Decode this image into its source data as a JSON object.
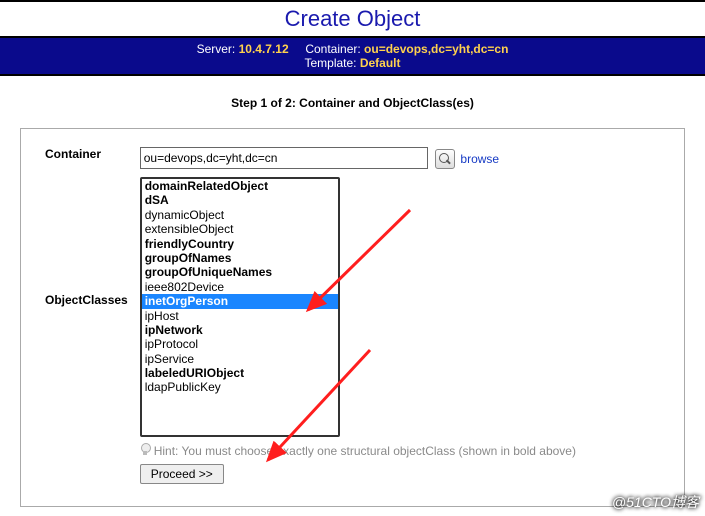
{
  "header": {
    "title": "Create Object",
    "server_label": "Server:",
    "server_value": "10.4.7.12",
    "container_label": "Container:",
    "container_value": "ou=devops,dc=yht,dc=cn",
    "template_label": "Template:",
    "template_value": "Default"
  },
  "step": "Step 1 of 2: Container and ObjectClass(es)",
  "form": {
    "container_label": "Container",
    "container_value": "ou=devops,dc=yht,dc=cn",
    "browse": "browse",
    "objectclasses_label": "ObjectClasses",
    "options": [
      {
        "label": "domainRelatedObject",
        "bold": true
      },
      {
        "label": "dSA",
        "bold": true
      },
      {
        "label": "dynamicObject",
        "bold": false
      },
      {
        "label": "extensibleObject",
        "bold": false
      },
      {
        "label": "friendlyCountry",
        "bold": true
      },
      {
        "label": "groupOfNames",
        "bold": true
      },
      {
        "label": "groupOfUniqueNames",
        "bold": true
      },
      {
        "label": "ieee802Device",
        "bold": false
      },
      {
        "label": "inetOrgPerson",
        "bold": true,
        "selected": true
      },
      {
        "label": "ipHost",
        "bold": false
      },
      {
        "label": "ipNetwork",
        "bold": true
      },
      {
        "label": "ipProtocol",
        "bold": false
      },
      {
        "label": "ipService",
        "bold": false
      },
      {
        "label": "labeledURIObject",
        "bold": true
      },
      {
        "label": "ldapPublicKey",
        "bold": false
      }
    ],
    "hint_label": "Hint:",
    "hint_text": " You must choose exactly one structural objectClass (shown in bold above)",
    "proceed": "Proceed >>"
  },
  "watermark": "@51CTO博客"
}
